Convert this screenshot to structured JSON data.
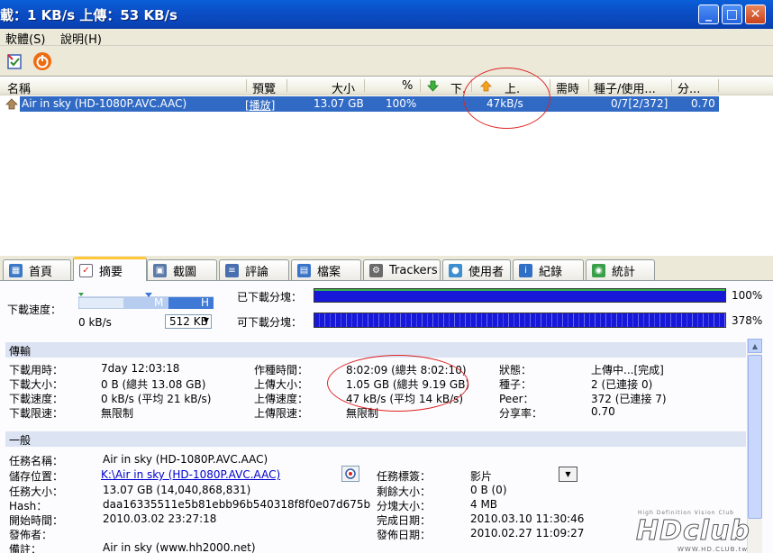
{
  "window": {
    "title": "載：1 KB/s   上傳：53 KB/s",
    "buttons": [
      "_",
      "□",
      "✕"
    ]
  },
  "menu": [
    {
      "label": "軟體(S)"
    },
    {
      "label": "說明(H)"
    }
  ],
  "toolbar": {
    "icons": [
      "add-torrent-icon",
      "power-icon"
    ]
  },
  "list": {
    "columns": [
      "名稱",
      "預覽",
      "大小",
      "%",
      "下.",
      "上.",
      "需時",
      "種子/使用...",
      "分..."
    ],
    "rows": [
      {
        "name": "Air in sky (HD-1080P.AVC.AAC)",
        "preview": "[播放]",
        "size": "13.07 GB",
        "percent": "100%",
        "upload": "47kB/s",
        "seeds_peers": "0/7[2/372]",
        "ratio": "0.70"
      }
    ]
  },
  "tabs": [
    {
      "label": "首頁"
    },
    {
      "label": "摘要"
    },
    {
      "label": "截圖"
    },
    {
      "label": "評論"
    },
    {
      "label": "檔案"
    },
    {
      "label": "Trackers"
    },
    {
      "label": "使用者"
    },
    {
      "label": "紀錄"
    },
    {
      "label": "統計"
    }
  ],
  "active_tab": "摘要",
  "speed": {
    "label": "下載速度：",
    "value": "0 kB/s",
    "markers": [
      "M",
      "H"
    ],
    "select_value": "512 KB"
  },
  "pieces": {
    "downloaded_label": "已下載分塊：",
    "downloaded_pct": "100%",
    "downloaded_fraction": 1.0,
    "available_label": "可下載分塊：",
    "available_pct": "378%"
  },
  "transfer": {
    "title": "傳輸",
    "rows": [
      {
        "l1": "下載用時：",
        "v1": "7day 12:03:18",
        "l2": "作種時間：",
        "v2": "8:02:09 (總共 8:02:10)",
        "l3": "狀態：",
        "v3": "上傳中...[完成]"
      },
      {
        "l1": "下載大小：",
        "v1": "0 B (總共 13.08 GB)",
        "l2": "上傳大小：",
        "v2": "1.05 GB (總共 9.19 GB)",
        "l3": "種子：",
        "v3": "2 (已連接 0)"
      },
      {
        "l1": "下載速度：",
        "v1": "0 kB/s (平均 21 kB/s)",
        "l2": "上傳速度：",
        "v2": "47 kB/s (平均 14 kB/s)",
        "l3": "Peer：",
        "v3": " 372 (已連接 7)"
      },
      {
        "l1": "下載限速：",
        "v1": "無限制",
        "l2": "上傳限速：",
        "v2": "無限制",
        "l3": "分享率：",
        "v3": "0.70"
      }
    ]
  },
  "general": {
    "title": "一般",
    "left": [
      {
        "label": "任務名稱：",
        "value": "Air in sky (HD-1080P.AVC.AAC)"
      },
      {
        "label": "儲存位置：",
        "value": "K:\\Air in sky (HD-1080P.AVC.AAC)"
      },
      {
        "label": "任務大小：",
        "value": "13.07 GB (14,040,868,831)"
      },
      {
        "label": "Hash：",
        "value": "daa16335511e5b81ebb96b540318f8f0e07d675b"
      },
      {
        "label": "開始時間：",
        "value": "2010.03.02 23:27:18"
      },
      {
        "label": "發佈者：",
        "value": ""
      },
      {
        "label": "備註：",
        "value": "Air in sky (www.hh2000.net)"
      }
    ],
    "right": [
      {
        "label": "任務標簽：",
        "value": "影片"
      },
      {
        "label": "剩餘大小：",
        "value": "0 B (0)"
      },
      {
        "label": "分塊大小：",
        "value": "4 MB"
      },
      {
        "label": "完成日期：",
        "value": "2010.03.10 11:30:46"
      },
      {
        "label": "發佈日期：",
        "value": "2010.02.27 11:09:27"
      }
    ]
  },
  "watermark": {
    "logo": "HDclub",
    "tagline": "High Definition Vision Club",
    "url": "WWW.HD.CLUB.tw"
  },
  "colors": {
    "titlebar": "#0b4fc6",
    "selection": "#316ac5",
    "piece_bar": "#1818d8",
    "annotation": "#d22222",
    "section": "#dce3f3"
  }
}
